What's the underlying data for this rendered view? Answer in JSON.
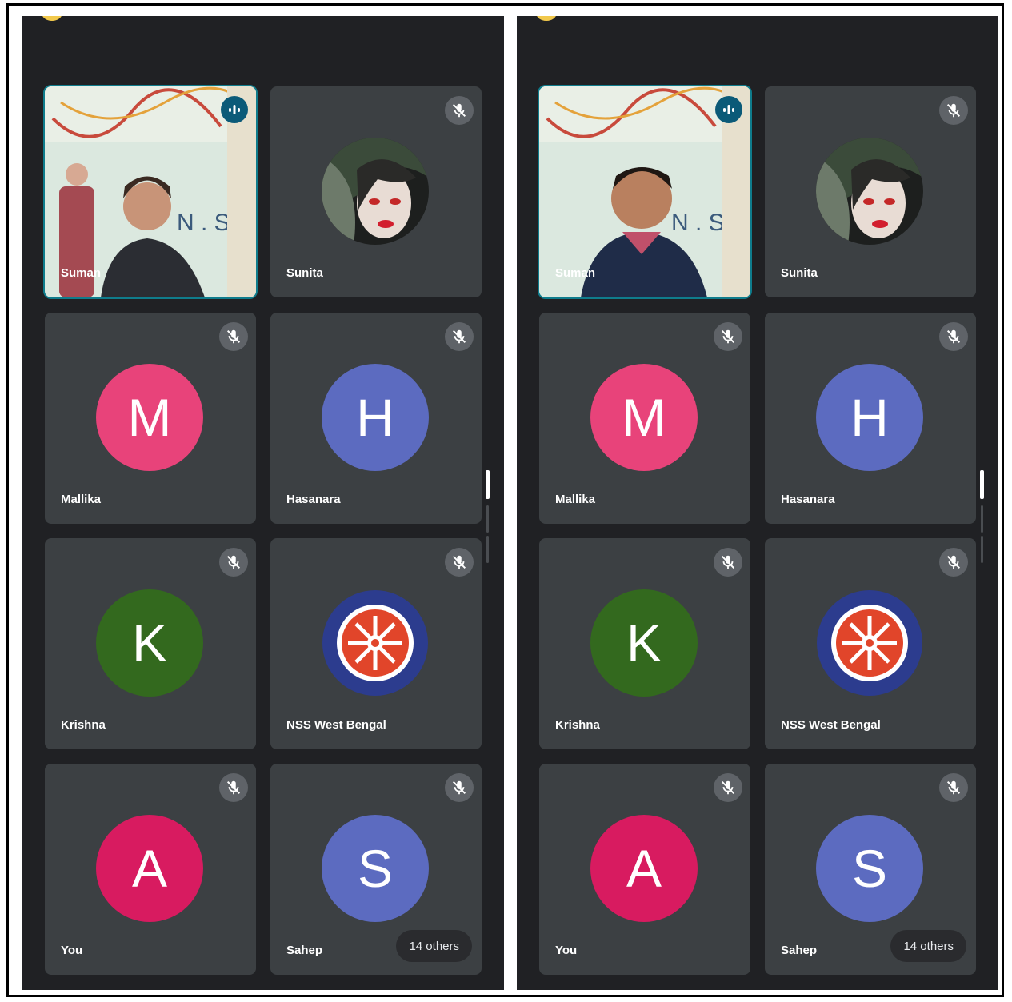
{
  "colors": {
    "background": "#202124",
    "tile": "#3c4043",
    "speaking_outline": "#0f7c8c",
    "mic_off_bg": "#5f6368"
  },
  "panels": [
    {
      "participants": [
        {
          "name": "Suman",
          "type": "video",
          "status": "speaking",
          "icon": "audio-wave-icon"
        },
        {
          "name": "Sunita",
          "type": "photo",
          "status": "muted",
          "icon": "mic-off-icon"
        },
        {
          "name": "Mallika",
          "type": "initial",
          "initial": "M",
          "color": "#e8437a",
          "status": "muted",
          "icon": "mic-off-icon"
        },
        {
          "name": "Hasanara",
          "type": "initial",
          "initial": "H",
          "color": "#5c6bc0",
          "status": "muted",
          "icon": "mic-off-icon"
        },
        {
          "name": "Krishna",
          "type": "initial",
          "initial": "K",
          "color": "#33691e",
          "status": "muted",
          "icon": "mic-off-icon"
        },
        {
          "name": "NSS West Bengal",
          "type": "logo",
          "status": "muted",
          "icon": "mic-off-icon"
        },
        {
          "name": "You",
          "type": "initial",
          "initial": "A",
          "color": "#d81b60",
          "status": "muted",
          "icon": "mic-off-icon"
        },
        {
          "name": "Sahep",
          "type": "initial",
          "initial": "S",
          "color": "#5c6bc0",
          "status": "muted",
          "icon": "mic-off-icon"
        }
      ],
      "others_label": "14 others"
    },
    {
      "participants": [
        {
          "name": "Suman",
          "type": "video",
          "status": "speaking",
          "icon": "audio-wave-icon"
        },
        {
          "name": "Sunita",
          "type": "photo",
          "status": "muted",
          "icon": "mic-off-icon"
        },
        {
          "name": "Mallika",
          "type": "initial",
          "initial": "M",
          "color": "#e8437a",
          "status": "muted",
          "icon": "mic-off-icon"
        },
        {
          "name": "Hasanara",
          "type": "initial",
          "initial": "H",
          "color": "#5c6bc0",
          "status": "muted",
          "icon": "mic-off-icon"
        },
        {
          "name": "Krishna",
          "type": "initial",
          "initial": "K",
          "color": "#33691e",
          "status": "muted",
          "icon": "mic-off-icon"
        },
        {
          "name": "NSS West Bengal",
          "type": "logo",
          "status": "muted",
          "icon": "mic-off-icon"
        },
        {
          "name": "You",
          "type": "initial",
          "initial": "A",
          "color": "#d81b60",
          "status": "muted",
          "icon": "mic-off-icon"
        },
        {
          "name": "Sahep",
          "type": "initial",
          "initial": "S",
          "color": "#5c6bc0",
          "status": "muted",
          "icon": "mic-off-icon"
        }
      ],
      "others_label": "14 others"
    }
  ]
}
